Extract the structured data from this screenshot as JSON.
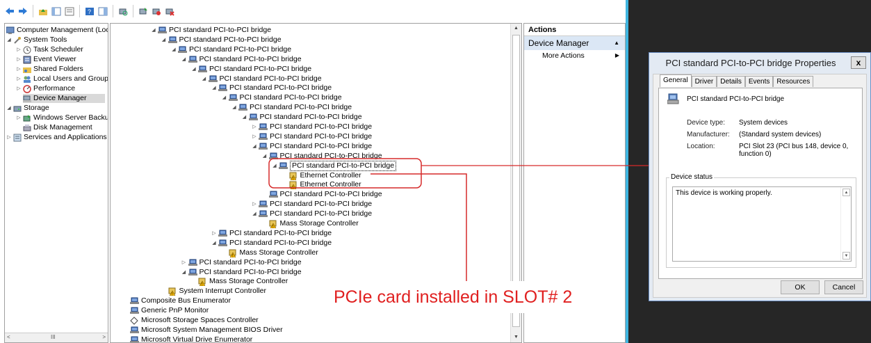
{
  "toolbar": {
    "buttons": [
      "back-arrow-icon",
      "forward-arrow-icon",
      "up-folder-icon",
      "show-hide-tree-icon",
      "properties-icon",
      "help-icon",
      "show-action-pane-icon",
      "scan-hardware-icon",
      "update-driver-icon",
      "disable-device-icon",
      "uninstall-device-icon"
    ]
  },
  "left_tree": {
    "items": [
      {
        "label": "Computer Management (Local",
        "level": 0,
        "expander": ""
      },
      {
        "label": "System Tools",
        "level": 1,
        "expander": "◢"
      },
      {
        "label": "Task Scheduler",
        "level": 2,
        "expander": "▷"
      },
      {
        "label": "Event Viewer",
        "level": 2,
        "expander": "▷"
      },
      {
        "label": "Shared Folders",
        "level": 2,
        "expander": "▷"
      },
      {
        "label": "Local Users and Groups",
        "level": 2,
        "expander": "▷"
      },
      {
        "label": "Performance",
        "level": 2,
        "expander": "▷"
      },
      {
        "label": "Device Manager",
        "level": 2,
        "expander": "",
        "selected": true
      },
      {
        "label": "Storage",
        "level": 1,
        "expander": "◢"
      },
      {
        "label": "Windows Server Backup",
        "level": 2,
        "expander": "▷"
      },
      {
        "label": "Disk Management",
        "level": 2,
        "expander": ""
      },
      {
        "label": "Services and Applications",
        "level": 1,
        "expander": "▷"
      }
    ],
    "scroll_label": "III"
  },
  "device_tree": {
    "items": [
      {
        "label": "PCI standard PCI-to-PCI bridge",
        "indent": 0,
        "expander": "◢",
        "icon": "pci-bridge"
      },
      {
        "label": "PCI standard PCI-to-PCI bridge",
        "indent": 1,
        "expander": "◢",
        "icon": "pci-bridge"
      },
      {
        "label": "PCI standard PCI-to-PCI bridge",
        "indent": 2,
        "expander": "◢",
        "icon": "pci-bridge"
      },
      {
        "label": "PCI standard PCI-to-PCI bridge",
        "indent": 3,
        "expander": "◢",
        "icon": "pci-bridge"
      },
      {
        "label": "PCI standard PCI-to-PCI bridge",
        "indent": 4,
        "expander": "◢",
        "icon": "pci-bridge"
      },
      {
        "label": "PCI standard PCI-to-PCI bridge",
        "indent": 5,
        "expander": "◢",
        "icon": "pci-bridge"
      },
      {
        "label": "PCI standard PCI-to-PCI bridge",
        "indent": 6,
        "expander": "◢",
        "icon": "pci-bridge"
      },
      {
        "label": "PCI standard PCI-to-PCI bridge",
        "indent": 7,
        "expander": "◢",
        "icon": "pci-bridge"
      },
      {
        "label": "PCI standard PCI-to-PCI bridge",
        "indent": 8,
        "expander": "◢",
        "icon": "pci-bridge"
      },
      {
        "label": "PCI standard PCI-to-PCI bridge",
        "indent": 9,
        "expander": "◢",
        "icon": "pci-bridge"
      },
      {
        "label": "PCI standard PCI-to-PCI bridge",
        "indent": 10,
        "expander": "▷",
        "icon": "pci-bridge"
      },
      {
        "label": "PCI standard PCI-to-PCI bridge",
        "indent": 10,
        "expander": "▷",
        "icon": "pci-bridge"
      },
      {
        "label": "PCI standard PCI-to-PCI bridge",
        "indent": 10,
        "expander": "◢",
        "icon": "pci-bridge"
      },
      {
        "label": "PCI standard PCI-to-PCI bridge",
        "indent": 11,
        "expander": "◢",
        "icon": "pci-bridge"
      },
      {
        "label": "PCI standard PCI-to-PCI bridge",
        "indent": 12,
        "expander": "◢",
        "icon": "pci-bridge",
        "selected": true
      },
      {
        "label": "Ethernet Controller",
        "indent": 13,
        "expander": "",
        "icon": "warning-device"
      },
      {
        "label": "Ethernet Controller",
        "indent": 13,
        "expander": "",
        "icon": "warning-device"
      },
      {
        "label": "PCI standard PCI-to-PCI bridge",
        "indent": 11,
        "expander": "",
        "icon": "pci-bridge"
      },
      {
        "label": "PCI standard PCI-to-PCI bridge",
        "indent": 10,
        "expander": "▷",
        "icon": "pci-bridge"
      },
      {
        "label": "PCI standard PCI-to-PCI bridge",
        "indent": 10,
        "expander": "◢",
        "icon": "pci-bridge"
      },
      {
        "label": "Mass Storage Controller",
        "indent": 11,
        "expander": "",
        "icon": "warning-device"
      },
      {
        "label": "PCI standard PCI-to-PCI bridge",
        "indent": 6,
        "expander": "▷",
        "icon": "pci-bridge"
      },
      {
        "label": "PCI standard PCI-to-PCI bridge",
        "indent": 6,
        "expander": "◢",
        "icon": "pci-bridge"
      },
      {
        "label": "Mass Storage Controller",
        "indent": 7,
        "expander": "",
        "icon": "warning-device"
      },
      {
        "label": "PCI standard PCI-to-PCI bridge",
        "indent": 3,
        "expander": "▷",
        "icon": "pci-bridge"
      },
      {
        "label": "PCI standard PCI-to-PCI bridge",
        "indent": 3,
        "expander": "◢",
        "icon": "pci-bridge"
      },
      {
        "label": "Mass Storage Controller",
        "indent": 4,
        "expander": "",
        "icon": "warning-device"
      },
      {
        "label": "System Interrupt Controller",
        "indent": 1,
        "expander": "",
        "icon": "warning-device"
      },
      {
        "label": "Composite Bus Enumerator",
        "indent": -1,
        "expander": "",
        "icon": "pci-bridge"
      },
      {
        "label": "Generic PnP Monitor",
        "indent": -1,
        "expander": "",
        "icon": "pci-bridge"
      },
      {
        "label": "Microsoft Storage Spaces Controller",
        "indent": -1,
        "expander": "",
        "icon": "storage-spaces"
      },
      {
        "label": "Microsoft System Management BIOS Driver",
        "indent": -1,
        "expander": "",
        "icon": "pci-bridge"
      },
      {
        "label": "Microsoft Virtual Drive Enumerator",
        "indent": -1,
        "expander": "",
        "icon": "pci-bridge"
      }
    ]
  },
  "actions": {
    "title": "Actions",
    "section": "Device Manager",
    "section_arrow": "▲",
    "more": "More Actions",
    "more_arrow": "▶"
  },
  "dialog": {
    "title": "PCI standard PCI-to-PCI bridge Properties",
    "close": "x",
    "tabs": [
      "General",
      "Driver",
      "Details",
      "Events",
      "Resources"
    ],
    "active_tab": 0,
    "device_name": "PCI standard PCI-to-PCI bridge",
    "device_type_label": "Device type:",
    "device_type": "System devices",
    "manufacturer_label": "Manufacturer:",
    "manufacturer": "(Standard system devices)",
    "location_label": "Location:",
    "location": "PCI Slot 23 (PCI bus 148, device 0, function 0)",
    "status_legend": "Device status",
    "status_text": "This device is working properly.",
    "ok": "OK",
    "cancel": "Cancel"
  },
  "annotation": {
    "text": "PCIe card installed in SLOT# 2",
    "color": "#e02020"
  },
  "colors": {
    "divider": "#3fb5e0",
    "dark_bg": "#262626",
    "selection": "#dbe7f5"
  }
}
